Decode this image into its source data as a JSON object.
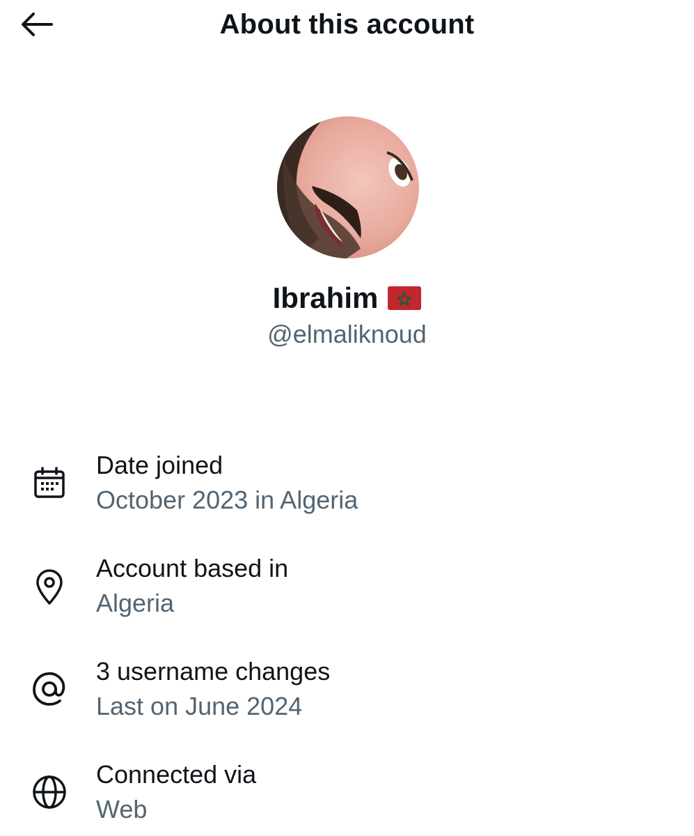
{
  "header": {
    "title": "About this account",
    "back_icon": "arrow-left-icon"
  },
  "profile": {
    "name": "Ibrahim",
    "flag_icon": "morocco-flag-icon",
    "handle": "@elmaliknoud"
  },
  "info_items": [
    {
      "icon": "calendar-icon",
      "title": "Date joined",
      "value": "October 2023 in Algeria"
    },
    {
      "icon": "location-pin-icon",
      "title": "Account based in",
      "value": "Algeria"
    },
    {
      "icon": "at-sign-icon",
      "title": "3 username changes",
      "value": "Last on June 2024"
    },
    {
      "icon": "globe-icon",
      "title": "Connected via",
      "value": "Web"
    }
  ],
  "colors": {
    "primary_text": "#0f1419",
    "secondary_text": "#536471",
    "background": "#ffffff",
    "flag_red": "#c1272d",
    "flag_green": "#006233"
  }
}
